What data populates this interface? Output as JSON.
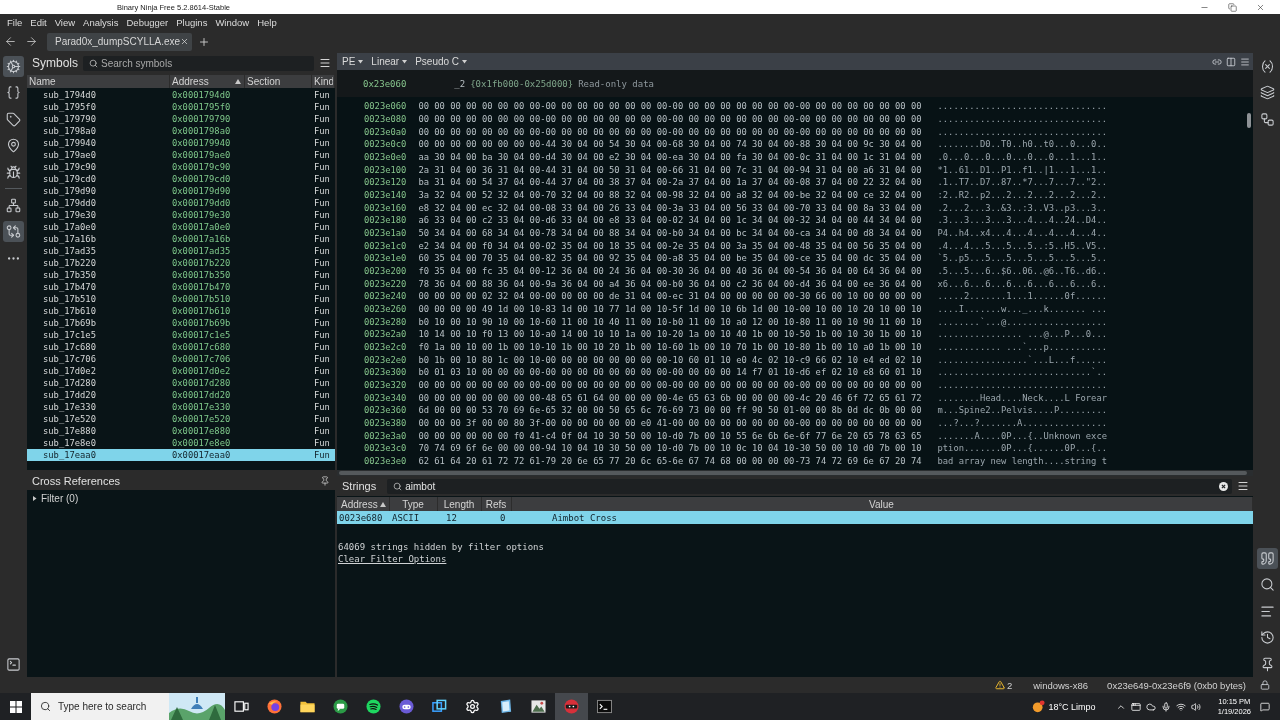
{
  "window": {
    "title": "Binary Ninja Free 5.2.8614-Stable"
  },
  "menu": [
    "File",
    "Edit",
    "View",
    "Analysis",
    "Debugger",
    "Plugins",
    "Window",
    "Help"
  ],
  "tabs": [
    {
      "label": "Parad0x_dumpSCYLLA.exe",
      "selected": true
    }
  ],
  "left_rail": {
    "groups": [
      [
        {
          "kind": "symbols",
          "selected": true
        },
        {
          "kind": "types",
          "selected": false
        },
        {
          "kind": "tags",
          "selected": false
        },
        {
          "kind": "locations",
          "selected": false
        },
        {
          "kind": "debugger",
          "selected": false
        }
      ],
      [
        {
          "kind": "hierarchy",
          "selected": false
        },
        {
          "kind": "compare",
          "selected": true
        },
        {
          "kind": "more",
          "selected": false
        }
      ]
    ],
    "bottom": [
      {
        "kind": "terminal",
        "selected": false
      }
    ]
  },
  "symbols": {
    "title": "Symbols",
    "search": {
      "placeholder": "Search symbols"
    },
    "columns": [
      {
        "label": "Name",
        "sorted": false
      },
      {
        "label": "Address",
        "sorted": true
      },
      {
        "label": "Section",
        "sorted": false
      },
      {
        "label": "Kind",
        "sorted": false
      }
    ],
    "rows": [
      {
        "name": "sub_1794d0",
        "address": "0x0001794d0",
        "symbol_kind": "Fun",
        "selected": false
      },
      {
        "name": "sub_1795f0",
        "address": "0x0001795f0",
        "symbol_kind": "Fun",
        "selected": false
      },
      {
        "name": "sub_179790",
        "address": "0x000179790",
        "symbol_kind": "Fun",
        "selected": false
      },
      {
        "name": "sub_1798a0",
        "address": "0x0001798a0",
        "symbol_kind": "Fun",
        "selected": false
      },
      {
        "name": "sub_179940",
        "address": "0x000179940",
        "symbol_kind": "Fun",
        "selected": false
      },
      {
        "name": "sub_179ae0",
        "address": "0x000179ae0",
        "symbol_kind": "Fun",
        "selected": false
      },
      {
        "name": "sub_179c90",
        "address": "0x000179c90",
        "symbol_kind": "Fun",
        "selected": false
      },
      {
        "name": "sub_179cd0",
        "address": "0x000179cd0",
        "symbol_kind": "Fun",
        "selected": false
      },
      {
        "name": "sub_179d90",
        "address": "0x000179d90",
        "symbol_kind": "Fun",
        "selected": false
      },
      {
        "name": "sub_179dd0",
        "address": "0x000179dd0",
        "symbol_kind": "Fun",
        "selected": false
      },
      {
        "name": "sub_179e30",
        "address": "0x000179e30",
        "symbol_kind": "Fun",
        "selected": false
      },
      {
        "name": "sub_17a0e0",
        "address": "0x00017a0e0",
        "symbol_kind": "Fun",
        "selected": false
      },
      {
        "name": "sub_17a16b",
        "address": "0x00017a16b",
        "symbol_kind": "Fun",
        "selected": false
      },
      {
        "name": "sub_17ad35",
        "address": "0x00017ad35",
        "symbol_kind": "Fun",
        "selected": false
      },
      {
        "name": "sub_17b220",
        "address": "0x00017b220",
        "symbol_kind": "Fun",
        "selected": false
      },
      {
        "name": "sub_17b350",
        "address": "0x00017b350",
        "symbol_kind": "Fun",
        "selected": false
      },
      {
        "name": "sub_17b470",
        "address": "0x00017b470",
        "symbol_kind": "Fun",
        "selected": false
      },
      {
        "name": "sub_17b510",
        "address": "0x00017b510",
        "symbol_kind": "Fun",
        "selected": false
      },
      {
        "name": "sub_17b610",
        "address": "0x00017b610",
        "symbol_kind": "Fun",
        "selected": false
      },
      {
        "name": "sub_17b69b",
        "address": "0x00017b69b",
        "symbol_kind": "Fun",
        "selected": false
      },
      {
        "name": "sub_17c1e5",
        "address": "0x00017c1e5",
        "symbol_kind": "Fun",
        "selected": false
      },
      {
        "name": "sub_17c680",
        "address": "0x00017c680",
        "symbol_kind": "Fun",
        "selected": false
      },
      {
        "name": "sub_17c706",
        "address": "0x00017c706",
        "symbol_kind": "Fun",
        "selected": false
      },
      {
        "name": "sub_17d0e2",
        "address": "0x00017d0e2",
        "symbol_kind": "Fun",
        "selected": false
      },
      {
        "name": "sub_17d280",
        "address": "0x00017d280",
        "symbol_kind": "Fun",
        "selected": false
      },
      {
        "name": "sub_17dd20",
        "address": "0x00017dd20",
        "symbol_kind": "Fun",
        "selected": false
      },
      {
        "name": "sub_17e330",
        "address": "0x00017e330",
        "symbol_kind": "Fun",
        "selected": false
      },
      {
        "name": "sub_17e520",
        "address": "0x00017e520",
        "symbol_kind": "Fun",
        "selected": false
      },
      {
        "name": "sub_17e880",
        "address": "0x00017e880",
        "symbol_kind": "Fun",
        "selected": false
      },
      {
        "name": "sub_17e8e0",
        "address": "0x00017e8e0",
        "symbol_kind": "Fun",
        "selected": false
      },
      {
        "name": "sub_17eaa0",
        "address": "0x00017eaa0",
        "symbol_kind": "Fun",
        "selected": true
      }
    ]
  },
  "cross_references": {
    "title": "Cross References",
    "filter": {
      "label": "Filter (0)",
      "expanded": false
    }
  },
  "view_bar": {
    "menus": [
      "PE",
      "Linear",
      "Pseudo C"
    ]
  },
  "section": {
    "address": "0x23e060",
    "name": "_2",
    "range": "{0x1fb000-0x25d000}",
    "description": "Read-only data"
  },
  "hex_rows": [
    {
      "address": "0023e060",
      "bytes": "00 00 00 00 00 00 00 00-00 00 00 00 00 00 00 00-00 00 00 00 00 00 00 00-00 00 00 00 00 00 00 00",
      "ascii": "................................"
    },
    {
      "address": "0023e080",
      "bytes": "00 00 00 00 00 00 00 00-00 00 00 00 00 00 00 00-00 00 00 00 00 00 00 00-00 00 00 00 00 00 00 00",
      "ascii": "................................"
    },
    {
      "address": "0023e0a0",
      "bytes": "00 00 00 00 00 00 00 00-00 00 00 00 00 00 00 00-00 00 00 00 00 00 00 00-00 00 00 00 00 00 00 00",
      "ascii": "................................"
    },
    {
      "address": "0023e0c0",
      "bytes": "00 00 00 00 00 00 00 00-44 30 04 00 54 30 04 00-68 30 04 00 74 30 04 00-88 30 04 00 9c 30 04 00",
      "ascii": "........D0..T0..h0..t0...0...0.."
    },
    {
      "address": "0023e0e0",
      "bytes": "aa 30 04 00 ba 30 04 00-d4 30 04 00 e2 30 04 00-ea 30 04 00 fa 30 04 00-0c 31 04 00 1c 31 04 00",
      "ascii": ".0...0...0...0...0...0...1...1.."
    },
    {
      "address": "0023e100",
      "bytes": "2a 31 04 00 36 31 04 00-44 31 04 00 50 31 04 00-66 31 04 00 7c 31 04 00-94 31 04 00 a6 31 04 00",
      "ascii": "*1..61..D1..P1..f1..|1...1...1.."
    },
    {
      "address": "0023e120",
      "bytes": "ba 31 04 00 54 37 04 00-44 37 04 00 38 37 04 00-2a 37 04 00 1a 37 04 00-08 37 04 00 22 32 04 00",
      "ascii": ".1..T7..D7..87..*7...7...7..\"2.."
    },
    {
      "address": "0023e140",
      "bytes": "3a 32 04 00 52 32 04 00-70 32 04 00 88 32 04 00-98 32 04 00 a8 32 04 00-be 32 04 00 ce 32 04 00",
      "ascii": ":2..R2..p2...2...2...2...2...2.."
    },
    {
      "address": "0023e160",
      "bytes": "e8 32 04 00 ec 32 04 00-08 33 04 00 26 33 04 00-3a 33 04 00 56 33 04 00-70 33 04 00 8a 33 04 00",
      "ascii": ".2...2...3..&3..:3..V3..p3...3.."
    },
    {
      "address": "0023e180",
      "bytes": "a6 33 04 00 c2 33 04 00-d6 33 04 00 e8 33 04 00-02 34 04 00 1c 34 04 00-32 34 04 00 44 34 04 00",
      "ascii": ".3...3...3...3...4...4..24..D4.."
    },
    {
      "address": "0023e1a0",
      "bytes": "50 34 04 00 68 34 04 00-78 34 04 00 88 34 04 00-b0 34 04 00 bc 34 04 00-ca 34 04 00 d8 34 04 00",
      "ascii": "P4..h4..x4...4...4...4...4...4.."
    },
    {
      "address": "0023e1c0",
      "bytes": "e2 34 04 00 f0 34 04 00-02 35 04 00 18 35 04 00-2e 35 04 00 3a 35 04 00-48 35 04 00 56 35 04 00",
      "ascii": ".4...4...5...5...5..:5..H5..V5.."
    },
    {
      "address": "0023e1e0",
      "bytes": "60 35 04 00 70 35 04 00-82 35 04 00 92 35 04 00-a8 35 04 00 be 35 04 00-ce 35 04 00 dc 35 04 00",
      "ascii": "`5..p5...5...5...5...5...5...5.."
    },
    {
      "address": "0023e200",
      "bytes": "f0 35 04 00 fc 35 04 00-12 36 04 00 24 36 04 00-30 36 04 00 40 36 04 00-54 36 04 00 64 36 04 00",
      "ascii": ".5...5...6..$6..06..@6..T6..d6.."
    },
    {
      "address": "0023e220",
      "bytes": "78 36 04 00 88 36 04 00-9a 36 04 00 a4 36 04 00-b0 36 04 00 c2 36 04 00-d4 36 04 00 ee 36 04 00",
      "ascii": "x6...6...6...6...6...6...6...6.."
    },
    {
      "address": "0023e240",
      "bytes": "00 00 00 00 02 32 04 00-00 00 00 00 de 31 04 00-ec 31 04 00 00 00 00 00-30 66 00 10 00 00 00 00",
      "ascii": ".....2.......1...1......0f......"
    },
    {
      "address": "0023e260",
      "bytes": "00 00 00 00 49 1d 00 10-83 1d 00 10 77 1d 00 10-5f 1d 00 10 6b 1d 00 10-00 10 00 10 20 10 00 10",
      "ascii": "....I.......w..._...k....... ..."
    },
    {
      "address": "0023e280",
      "bytes": "b0 10 00 10 90 10 00 10-60 11 00 10 40 11 00 10-b0 11 00 10 a0 12 00 10-80 11 00 10 90 11 00 10",
      "ascii": "........`...@..................."
    },
    {
      "address": "0023e2a0",
      "bytes": "10 14 00 10 f0 13 00 10-a0 14 00 10 10 1a 00 10-20 1a 00 10 40 1b 00 10-50 1b 00 10 30 1b 00 10",
      "ascii": "................ ...@...P...0..."
    },
    {
      "address": "0023e2c0",
      "bytes": "f0 1a 00 10 00 1b 00 10-10 1b 00 10 20 1b 00 10-60 1b 00 10 70 1b 00 10-80 1b 00 10 a0 1b 00 10",
      "ascii": "............ ...`...p..........."
    },
    {
      "address": "0023e2e0",
      "bytes": "b0 1b 00 10 80 1c 00 10-00 00 00 00 00 00 00 00-10 60 01 10 e0 4c 02 10-c9 66 02 10 e4 ed 02 10",
      "ascii": ".................`...L...f......"
    },
    {
      "address": "0023e300",
      "bytes": "b0 01 03 10 00 00 00 00-00 00 00 00 00 00 00 00-00 00 00 00 14 f7 01 10-d6 ef 02 10 e8 60 01 10",
      "ascii": ".............................`.."
    },
    {
      "address": "0023e320",
      "bytes": "00 00 00 00 00 00 00 00-00 00 00 00 00 00 00 00-00 00 00 00 00 00 00 00-00 00 00 00 00 00 00 00",
      "ascii": "................................"
    },
    {
      "address": "0023e340",
      "bytes": "00 00 00 00 00 00 00 00-48 65 61 64 00 00 00 00-4e 65 63 6b 00 00 00 00-4c 20 46 6f 72 65 61 72",
      "ascii": "........Head....Neck....L Forear"
    },
    {
      "address": "0023e360",
      "bytes": "6d 00 00 00 53 70 69 6e-65 32 00 00 50 65 6c 76-69 73 00 00 ff 90 50 01-00 00 8b 0d dc 0b 00 00",
      "ascii": "m...Spine2..Pelvis....P........."
    },
    {
      "address": "0023e380",
      "bytes": "00 00 00 3f 00 00 80 3f-00 00 00 00 00 00 e0 41-00 00 00 00 00 00 00 00-00 00 00 00 00 00 00 00",
      "ascii": "...?...?.......A................"
    },
    {
      "address": "0023e3a0",
      "bytes": "00 00 00 00 00 00 f0 41-c4 0f 04 10 30 50 00 10-d0 7b 00 10 55 6e 6b 6e-6f 77 6e 20 65 78 63 65",
      "ascii": ".......A....0P...{..Unknown exce"
    },
    {
      "address": "0023e3c0",
      "bytes": "70 74 69 6f 6e 00 00 00-94 10 04 10 30 50 00 10-d0 7b 00 10 0c 10 04 10-30 50 00 10 d0 7b 00 10",
      "ascii": "ption.......0P...{......0P...{.."
    },
    {
      "address": "0023e3e0",
      "bytes": "62 61 64 20 61 72 72 61-79 20 6e 65 77 20 6c 65-6e 67 74 68 00 00 00 00-73 74 72 69 6e 67 20 74",
      "ascii": "bad array new length....string t"
    }
  ],
  "strings": {
    "title": "Strings",
    "search": {
      "value": "aimbot"
    },
    "columns": [
      {
        "label": "Address",
        "sorted": true
      },
      {
        "label": "Type",
        "sorted": false
      },
      {
        "label": "Length",
        "sorted": false
      },
      {
        "label": "Refs",
        "sorted": false
      },
      {
        "label": "Value",
        "sorted": false
      }
    ],
    "rows": [
      {
        "address": "0023e680",
        "type": "ASCII",
        "length": "12",
        "refs": "0",
        "value": "Aimbot Cross",
        "selected": true
      }
    ],
    "hidden_note": "64069 strings hidden by filter options",
    "clear_link": "Clear Filter Options"
  },
  "right_rail": {
    "top": [
      {
        "kind": "variables",
        "selected": false
      },
      {
        "kind": "layers",
        "selected": false
      },
      {
        "kind": "flow",
        "selected": false
      }
    ],
    "bottom": [
      {
        "kind": "strings",
        "selected": true
      },
      {
        "kind": "search",
        "selected": false
      },
      {
        "kind": "text",
        "selected": false
      },
      {
        "kind": "history",
        "selected": false
      },
      {
        "kind": "pin",
        "selected": false
      }
    ]
  },
  "status_bar": {
    "warnings": "2",
    "platform": "windows-x86",
    "selection": "0x23e649-0x23e6f9 (0xb0 bytes)"
  },
  "taskbar": {
    "search": {
      "placeholder": "Type here to search"
    },
    "apps": [
      {
        "kind": "task_view",
        "active": false
      },
      {
        "kind": "browser",
        "active": false
      },
      {
        "kind": "files",
        "active": false
      },
      {
        "kind": "chat",
        "active": false
      },
      {
        "kind": "music",
        "active": false
      },
      {
        "kind": "game",
        "active": false
      },
      {
        "kind": "windows",
        "active": false
      },
      {
        "kind": "settings",
        "active": false
      },
      {
        "kind": "notes",
        "active": false
      },
      {
        "kind": "image",
        "active": false
      },
      {
        "kind": "ninja",
        "active": true
      },
      {
        "kind": "terminal",
        "active": false
      }
    ],
    "weather": "18°C Limpo",
    "time": "10:15 PM",
    "date": "1/19/2026"
  }
}
